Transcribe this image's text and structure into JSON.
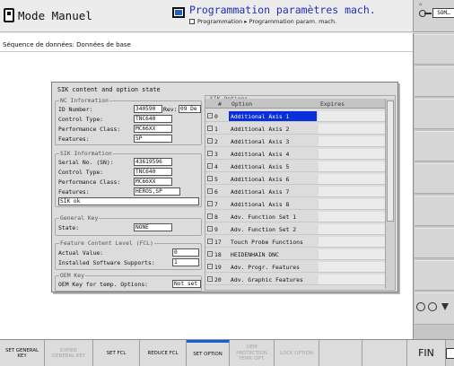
{
  "header": {
    "mode_label": "Mode Manuel",
    "program_title": "Programmation paramètres mach.",
    "breadcrumb_a": "Programmation",
    "breadcrumb_b": "Programmation param. mach.",
    "right_top": "⌂",
    "right_box": "SOM…"
  },
  "workspace": {
    "sequence_label": "Séquence de données: Données de base"
  },
  "dialog": {
    "title": "SIK content and option state",
    "nc": {
      "group_title": "NC Information",
      "id_label": "ID Number:",
      "id_value": "340590",
      "rev_label": "Rev:",
      "rev_value": "09 De",
      "control_label": "Control Type:",
      "control_value": "TNC640",
      "perf_label": "Performance Class:",
      "perf_value": "MC66XX",
      "features_label": "Features:",
      "features_value": "SP"
    },
    "sik": {
      "group_title": "SIK Information",
      "serial_label": "Serial No. (SN):",
      "serial_value": "43619596",
      "control_label": "Control Type:",
      "control_value": "TNC640",
      "perf_label": "Performance Class:",
      "perf_value": "MC66XX",
      "features_label": "Features:",
      "features_value": "HEROS,SP",
      "status_value": "SIK ok"
    },
    "general_key": {
      "group_title": "General Key",
      "state_label": "State:",
      "state_value": "NONE"
    },
    "fcl": {
      "group_title": "Feature Content Level (FCL)",
      "actual_label": "Actual Value:",
      "actual_value": "0",
      "installed_label": "Installed Software Supports:",
      "installed_value": "1"
    },
    "oem": {
      "group_title": "OEM Key",
      "label": "OEM Key for temp. Options:",
      "value": "Not set"
    },
    "options": {
      "group_title": "SIK Options",
      "col_num": "#",
      "col_option": "Option",
      "col_expires": "Expires",
      "rows": [
        {
          "check": "☒",
          "num": "0",
          "option": "Additional Axis 1"
        },
        {
          "check": "☒",
          "num": "1",
          "option": "Additional Axis 2"
        },
        {
          "check": "☒",
          "num": "2",
          "option": "Additional Axis 3"
        },
        {
          "check": "☒",
          "num": "3",
          "option": "Additional Axis 4"
        },
        {
          "check": "☒",
          "num": "4",
          "option": "Additional Axis 5"
        },
        {
          "check": "☒",
          "num": "5",
          "option": "Additional Axis 6"
        },
        {
          "check": "☒",
          "num": "6",
          "option": "Additional Axis 7"
        },
        {
          "check": "☒",
          "num": "7",
          "option": "Additional Axis 8"
        },
        {
          "check": "☒",
          "num": "8",
          "option": "Adv. Function Set 1"
        },
        {
          "check": "☒",
          "num": "9",
          "option": "Adv. Function Set 2"
        },
        {
          "check": "☒",
          "num": "17",
          "option": "Touch Probe Functions"
        },
        {
          "check": "☒",
          "num": "18",
          "option": "HEIDENHAIN DNC"
        },
        {
          "check": "☒",
          "num": "19",
          "option": "Adv. Progr. Features"
        },
        {
          "check": "☒",
          "num": "20",
          "option": "Adv. Graphic Features"
        }
      ]
    }
  },
  "softkeys": {
    "set_general_key": "SET GENERAL\nKEY",
    "expire_general_key": "EXPIRE\nGENERAL KEY",
    "set_fcl": "SET FCL",
    "reduce_fcl": "REDUCE FCL",
    "set_option": "SET OPTION",
    "oem_protection": "OEM\nPROTECTION\nTEMP. OPT.",
    "lock_option": "LOCK OPTION",
    "fin": "FIN"
  },
  "colors": {
    "selection": "#0a2fd9",
    "title_blue": "#1f2fb8",
    "active_tab": "#1a5fd8"
  }
}
